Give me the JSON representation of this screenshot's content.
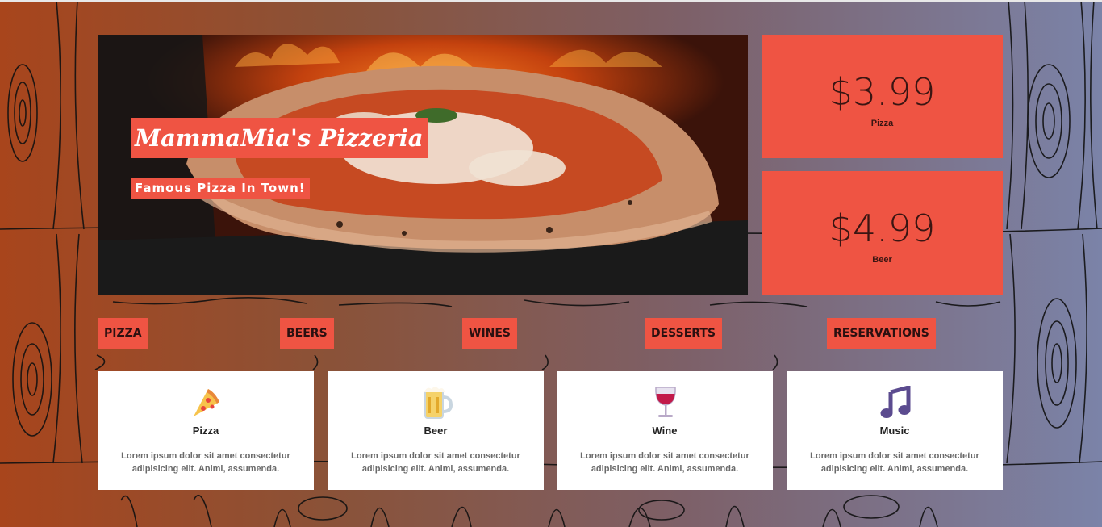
{
  "hero": {
    "title": "MammaMia's Pizzeria",
    "subtitle": "Famous Pizza In Town!"
  },
  "prices": [
    {
      "amount": "$3.99",
      "item": "Pizza"
    },
    {
      "amount": "$4.99",
      "item": "Beer"
    }
  ],
  "menu": [
    "PIZZA",
    "BEERS",
    "WINES",
    "DESSERTS",
    "RESERVATIONS"
  ],
  "cards": [
    {
      "icon": "pizza-icon",
      "title": "Pizza",
      "text": "Lorem ipsum dolor sit amet consectetur adipisicing elit. Animi, assumenda."
    },
    {
      "icon": "beer-mug-icon",
      "title": "Beer",
      "text": "Lorem ipsum dolor sit amet consectetur adipisicing elit. Animi, assumenda."
    },
    {
      "icon": "wine-glass-icon",
      "title": "Wine",
      "text": "Lorem ipsum dolor sit amet consectetur adipisicing elit. Animi, assumenda."
    },
    {
      "icon": "music-note-icon",
      "title": "Music",
      "text": "Lorem ipsum dolor sit amet consectetur adipisicing elit. Animi, assumenda."
    }
  ],
  "colors": {
    "accent": "#ef5443",
    "card_background": "#ffffff",
    "price_text": "#3a1512"
  }
}
